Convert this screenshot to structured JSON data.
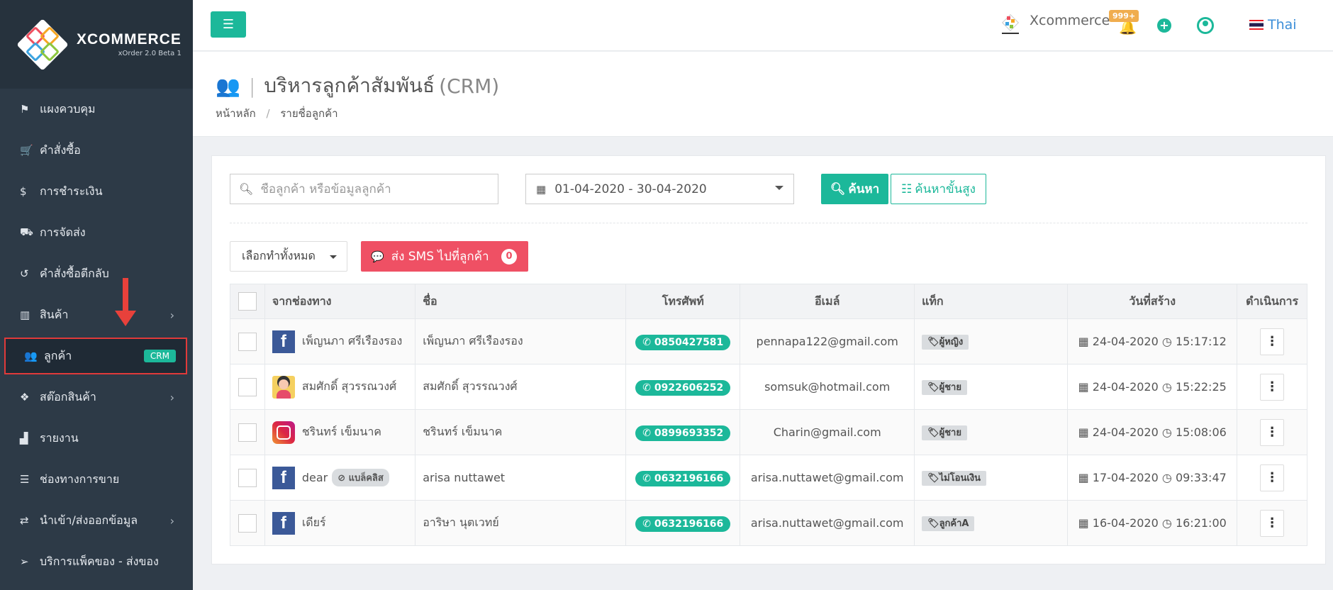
{
  "brand": {
    "name": "XCOMMERCE",
    "version": "xOrder 2.0 Beta 1"
  },
  "sidebar": {
    "items": [
      {
        "label": "แผงควบคุม",
        "icon": "flag-icon",
        "glyph": "⚑"
      },
      {
        "label": "คำสั่งซื้อ",
        "icon": "cart-icon",
        "glyph": "🛒"
      },
      {
        "label": "การชำระเงิน",
        "icon": "dollar-icon",
        "glyph": "$"
      },
      {
        "label": "การจัดส่ง",
        "icon": "truck-icon",
        "glyph": "⛟"
      },
      {
        "label": "คำสั่งซื้อตีกลับ",
        "icon": "undo-icon",
        "glyph": "↺"
      },
      {
        "label": "สินค้า",
        "icon": "barcode-icon",
        "glyph": "▥"
      },
      {
        "label": "ลูกค้า",
        "icon": "users-icon",
        "glyph": "👥",
        "badge": "CRM"
      },
      {
        "label": "สต๊อกสินค้า",
        "icon": "cubes-icon",
        "glyph": "❖"
      },
      {
        "label": "รายงาน",
        "icon": "bar-chart-icon",
        "glyph": "▟"
      },
      {
        "label": "ช่องทางการขาย",
        "icon": "list-icon",
        "glyph": "☰"
      },
      {
        "label": "นำเข้า/ส่งออกข้อมูล",
        "icon": "exchange-icon",
        "glyph": "⇄"
      },
      {
        "label": "บริการแพ็คของ - ส่งของ",
        "icon": "send-icon",
        "glyph": "➢"
      }
    ]
  },
  "topbar": {
    "shop_name": "Xcommerce",
    "notification_count": "999+",
    "language": "Thai"
  },
  "page": {
    "title": "บริหารลูกค้าสัมพันธ์",
    "title_suffix": "(CRM)",
    "breadcrumb": [
      "หน้าหลัก",
      "รายชื่อลูกค้า"
    ]
  },
  "filters": {
    "search_placeholder": "ชื่อลูกค้า หรือข้อมูลลูกค้า",
    "date_range": "01-04-2020 - 30-04-2020",
    "search_label": "ค้นหา",
    "advanced_label": "ค้นหาขั้นสูง",
    "bulk_label": "เลือกทำทั้งหมด",
    "sms_label": "ส่ง SMS ไปที่ลูกค้า",
    "sms_count": "0"
  },
  "table": {
    "headers": [
      "",
      "จากช่องทาง",
      "ชื่อ",
      "โทรศัพท์",
      "อีเมล์",
      "แท็ก",
      "วันที่สร้าง",
      "ดำเนินการ"
    ],
    "rows": [
      {
        "channel": "facebook",
        "channel_name": "เพ็ญนภา ศรีเรืองรอง",
        "blacklist": "",
        "name": "เพ็ญนภา ศรีเรืองรอง",
        "phone": "0850427581",
        "email": "pennapa122@gmail.com",
        "tag": "ผู้หญิง",
        "date": "24-04-2020",
        "time": "15:17:12"
      },
      {
        "channel": "avatar",
        "channel_name": "สมศักดิ์ สุวรรณวงศ์",
        "blacklist": "",
        "name": "สมศักดิ์ สุวรรณวงศ์",
        "phone": "0922606252",
        "email": "somsuk@hotmail.com",
        "tag": "ผู้ชาย",
        "date": "24-04-2020",
        "time": "15:22:25"
      },
      {
        "channel": "instagram",
        "channel_name": "ชรินทร์ เข็มนาค",
        "blacklist": "",
        "name": "ชรินทร์ เข็มนาค",
        "phone": "0899693352",
        "email": "Charin@gmail.com",
        "tag": "ผู้ชาย",
        "date": "24-04-2020",
        "time": "15:08:06"
      },
      {
        "channel": "facebook",
        "channel_name": "dear",
        "blacklist": "แบล็คลิส",
        "name": "arisa nuttawet",
        "phone": "0632196166",
        "email": "arisa.nuttawet@gmail.com",
        "tag": "ไม่โอนเงิน",
        "date": "17-04-2020",
        "time": "09:33:47"
      },
      {
        "channel": "facebook",
        "channel_name": "เดียร์",
        "blacklist": "",
        "name": "อาริษา นุตเวทย์",
        "phone": "0632196166",
        "email": "arisa.nuttawet@gmail.com",
        "tag": "ลูกค้าA",
        "date": "16-04-2020",
        "time": "16:21:00"
      }
    ]
  }
}
